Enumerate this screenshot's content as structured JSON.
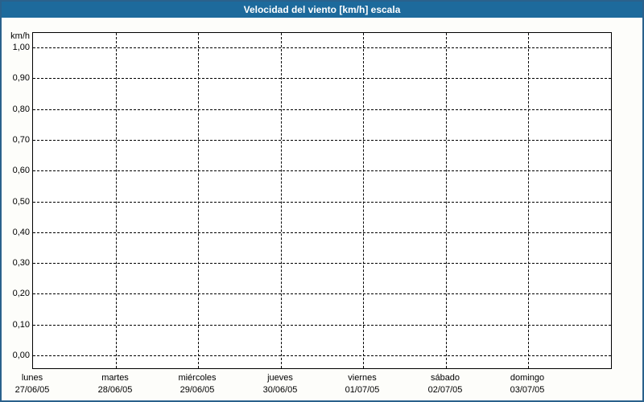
{
  "window": {
    "title": "Velocidad del viento [km/h] escala",
    "colors": {
      "titlebar_bg": "#1d6a9c",
      "titlebar_text": "#ffffff",
      "window_border": "#2a618c",
      "window_bg": "#fdfdfa",
      "plot_bg": "#ffffff",
      "grid": "#000000",
      "label_text": "#000000"
    }
  },
  "chart_data": {
    "type": "line",
    "title": "Velocidad del viento [km/h] escala",
    "ylabel": "km/h",
    "xlabel": "",
    "ylim": [
      0.0,
      1.0
    ],
    "y_tick_step": 0.1,
    "y_tick_labels": [
      "1,00",
      "0,90",
      "0,80",
      "0,70",
      "0,60",
      "0,50",
      "0,40",
      "0,30",
      "0,20",
      "0,10",
      "0,00"
    ],
    "x_categories": [
      {
        "day": "lunes",
        "date": "27/06/05"
      },
      {
        "day": "martes",
        "date": "28/06/05"
      },
      {
        "day": "miércoles",
        "date": "29/06/05"
      },
      {
        "day": "jueves",
        "date": "30/06/05"
      },
      {
        "day": "viernes",
        "date": "01/07/05"
      },
      {
        "day": "sábado",
        "date": "02/07/05"
      },
      {
        "day": "domingo",
        "date": "03/07/05"
      }
    ],
    "series": [],
    "grid": {
      "style": "dashed",
      "horizontal": true,
      "vertical": true
    },
    "legend": "none"
  }
}
